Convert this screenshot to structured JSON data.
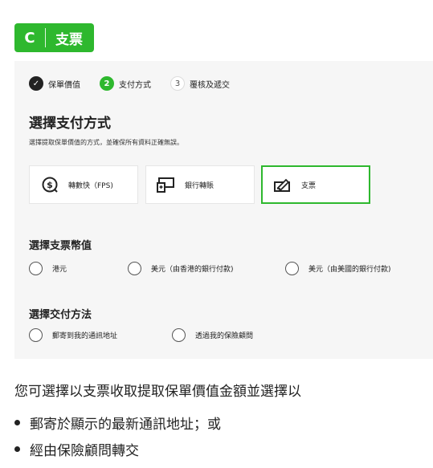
{
  "badge": {
    "letter": "C",
    "label": "支票"
  },
  "stepper": {
    "steps": [
      {
        "marker": "✓",
        "label": "保單價值",
        "state": "done"
      },
      {
        "marker": "2",
        "label": "支付方式",
        "state": "active"
      },
      {
        "marker": "3",
        "label": "覆核及遞交",
        "state": "todo"
      }
    ]
  },
  "page": {
    "title": "選擇支付方式",
    "subtitle": "選擇提取保單價值的方式，並確保所有資料正確無誤。"
  },
  "methods": [
    {
      "label": "轉數快（FPS)",
      "icon": "fps-icon",
      "selected": false
    },
    {
      "label": "銀行轉賬",
      "icon": "bank-transfer-icon",
      "selected": false
    },
    {
      "label": "支票",
      "icon": "cheque-icon",
      "selected": true
    }
  ],
  "currency": {
    "title": "選擇支票幣值",
    "options": [
      "港元",
      "美元（由香港的銀行付款)",
      "美元（由美國的銀行付款)"
    ]
  },
  "delivery": {
    "title": "選擇交付方法",
    "options": [
      "郵寄到我的通訊地址",
      "透過我的保險顧問"
    ]
  },
  "explanation": {
    "text": "您可選擇以支票收取提取保單價值金額並選擇以",
    "bullets": [
      "郵寄於顯示的最新通訊地址；或",
      "經由保險顧問轉交"
    ]
  },
  "colors": {
    "accent": "#2eb82e",
    "panel": "#f6f6f6"
  }
}
